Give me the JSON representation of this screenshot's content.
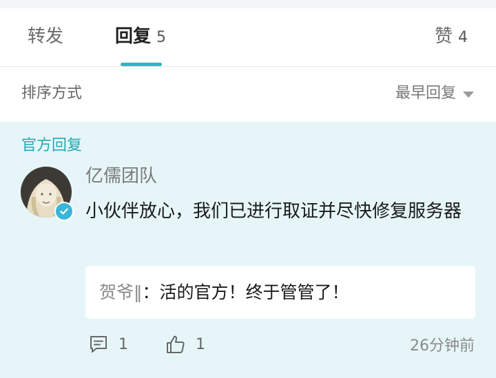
{
  "tabs": [
    {
      "label": "转发",
      "count": ""
    },
    {
      "label": "回复",
      "count": "5"
    },
    {
      "label": "赞",
      "count": "4"
    }
  ],
  "sort": {
    "label": "排序方式",
    "selected": "最早回复"
  },
  "official": {
    "section_title": "官方回复",
    "author": "亿儒团队",
    "content": "小伙伴放心，我们已进行取证并尽快修复服务器",
    "reply": {
      "user": "贺爷‖",
      "separator": "：",
      "text": "活的官方！终于管管了！"
    },
    "comment_count": "1",
    "like_count": "1",
    "time": "26分钟前"
  },
  "colors": {
    "accent": "#2ab7c0",
    "verified": "#39b6d8",
    "section_bg": "#e6f6f8"
  },
  "icons": {
    "comment": "comment-icon",
    "like": "thumbs-up-icon",
    "verified": "verified-badge-icon",
    "sort": "caret-down-icon"
  }
}
